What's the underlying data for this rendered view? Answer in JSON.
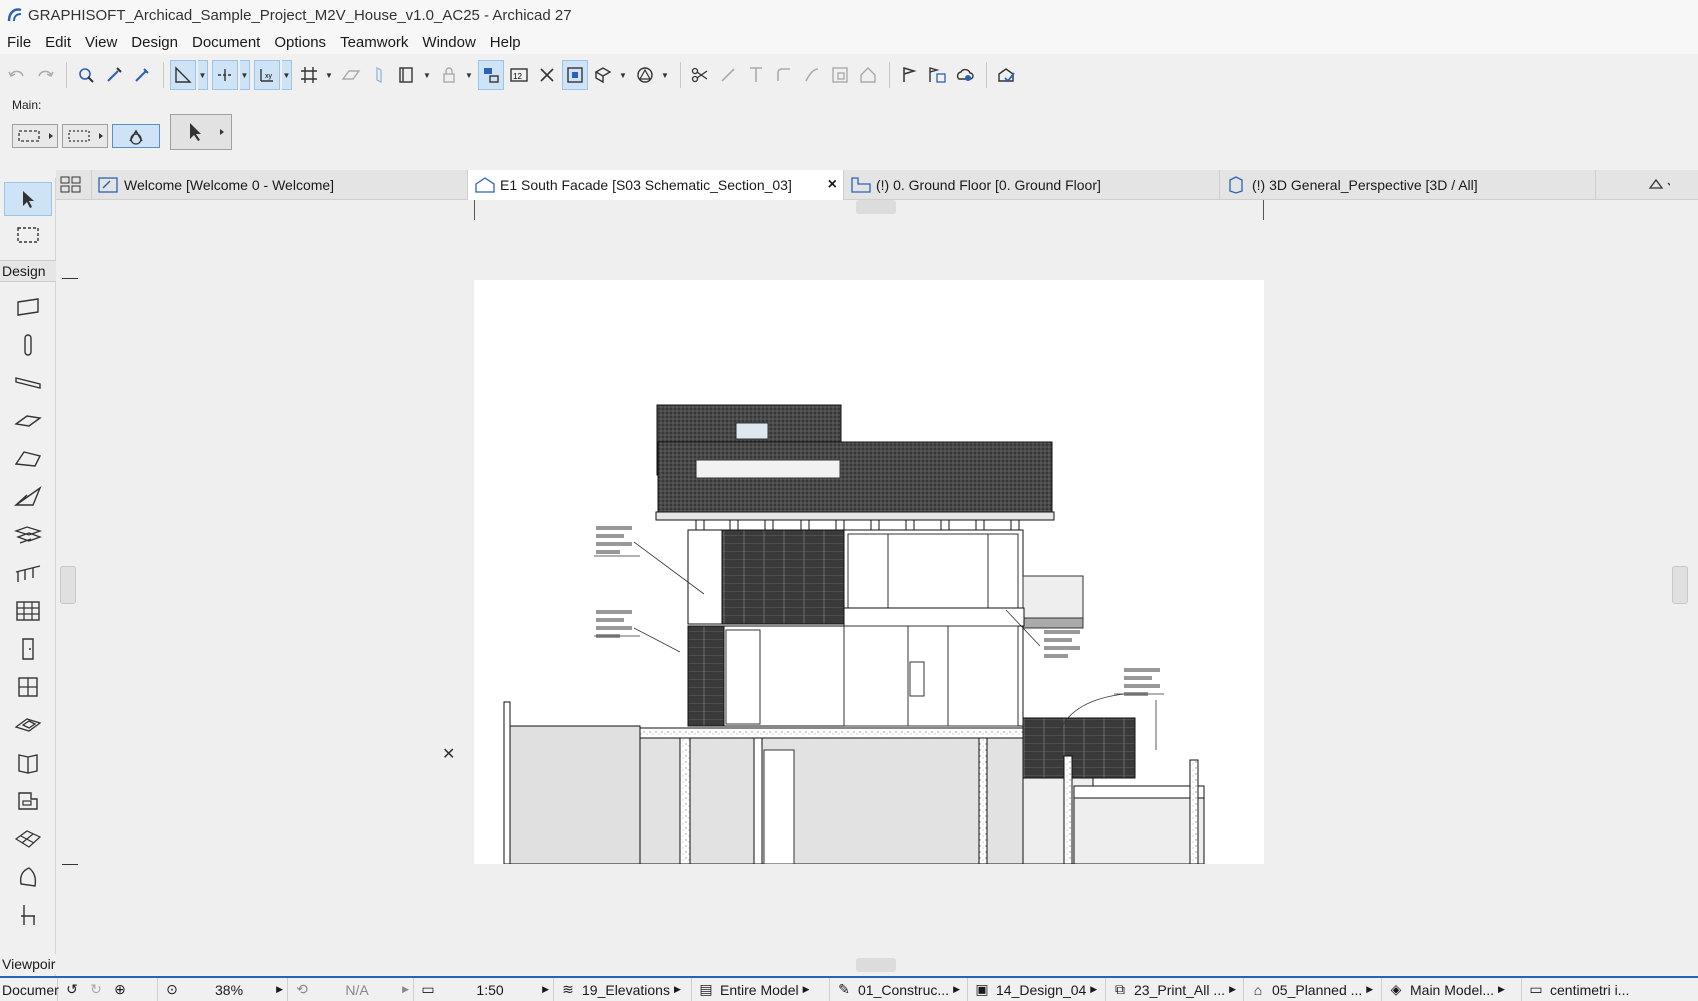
{
  "window": {
    "title": "GRAPHISOFT_Archicad_Sample_Project_M2V_House_v1.0_AC25 - Archicad 27"
  },
  "menu": [
    "File",
    "Edit",
    "View",
    "Design",
    "Document",
    "Options",
    "Teamwork",
    "Window",
    "Help"
  ],
  "infobox": {
    "label": "Main:"
  },
  "toolbox": {
    "design_label": "Design",
    "viewpoint_label": "Viewpoir"
  },
  "tabs": [
    {
      "label": "Welcome [Welcome 0 - Welcome]",
      "icon": "welcome-icon"
    },
    {
      "label": "E1 South Facade [S03 Schematic_Section_03]",
      "icon": "elevation-icon"
    },
    {
      "label": "(!) 0. Ground Floor [0. Ground Floor]",
      "icon": "floor-plan-icon"
    },
    {
      "label": "(!) 3D General_Perspective [3D / All]",
      "icon": "3d-icon"
    }
  ],
  "tab_close": "×",
  "status": {
    "document": "Documer",
    "zoom": "38%",
    "angle": "N/A",
    "scale": "1:50",
    "layer_combo": "19_Elevations",
    "model_view": "Entire Model",
    "pen_set": "01_Construc...",
    "graphic_override": "14_Design_04",
    "dimension": "23_Print_All ...",
    "renovation": "05_Planned ...",
    "structure": "Main Model...",
    "units": "centimetri i..."
  },
  "colors": {
    "accent": "#2a63b6",
    "active_tab": "#ffffff",
    "selected": "#cfe3f7"
  }
}
